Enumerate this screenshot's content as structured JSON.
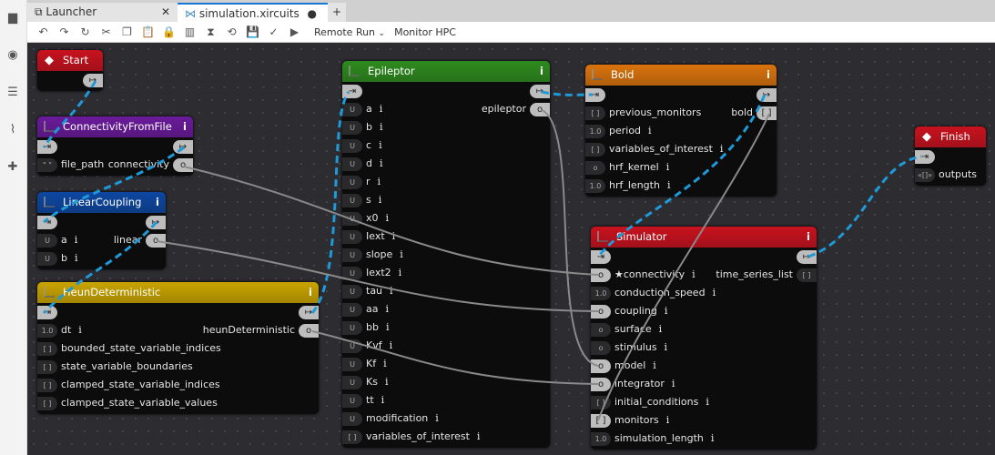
{
  "sidebar": {
    "icons": [
      "folder-icon",
      "running-icon",
      "list-icon",
      "xircuits-components-icon",
      "extension-icon"
    ]
  },
  "tabs": [
    {
      "label": "Launcher",
      "active": false
    },
    {
      "label": "simulation.xircuits",
      "active": true
    }
  ],
  "toolbar": {
    "icons": [
      "undo-icon",
      "redo-icon",
      "reload-icon",
      "cut-icon",
      "copy-icon",
      "paste-icon",
      "lock-icon",
      "compile-icon",
      "hourglass-icon",
      "debug-icon",
      "save-icon",
      "check-icon",
      "run-icon"
    ],
    "run_type": "Remote Run",
    "monitor": "Monitor HPC"
  },
  "colors": {
    "flow_link": "#1f9ad8",
    "data_link": "#8a8a8a"
  },
  "nodes": [
    {
      "id": "start",
      "title": "Start",
      "color": "#c8121e",
      "kind": "start",
      "rows": [
        {
          "out": {
            "badge": "⇥"
          }
        }
      ]
    },
    {
      "id": "cff",
      "title": "ConnectivityFromFile",
      "color": "#6a1b9a",
      "rows": [
        {
          "in": {
            "badge": "⇥"
          },
          "out": {
            "badge": "⇥"
          }
        },
        {
          "in": {
            "badge": "\" \"",
            "label": "file_path"
          },
          "out": {
            "badge": "o",
            "label": "connectivity",
            "light": true
          }
        }
      ]
    },
    {
      "id": "lc",
      "title": "LinearCoupling",
      "color": "#0d47a1",
      "rows": [
        {
          "in": {
            "badge": "⇥"
          },
          "out": {
            "badge": "⇥"
          }
        },
        {
          "in": {
            "badge": "U",
            "label": "a",
            "info": true
          },
          "out": {
            "badge": "o",
            "label": "linear",
            "light": true
          }
        },
        {
          "in": {
            "badge": "U",
            "label": "b",
            "info": true
          }
        }
      ]
    },
    {
      "id": "heun",
      "title": "HeunDeterministic",
      "color": "#c9a400",
      "rows": [
        {
          "in": {
            "badge": "⇥"
          },
          "out": {
            "badge": "⇥"
          }
        },
        {
          "in": {
            "badge": "1.0",
            "label": "dt",
            "info": true
          },
          "out": {
            "badge": "o",
            "label": "heunDeterministic",
            "light": true
          }
        },
        {
          "in": {
            "badge": "[ ]",
            "label": "bounded_state_variable_indices"
          }
        },
        {
          "in": {
            "badge": "[ ]",
            "label": "state_variable_boundaries"
          }
        },
        {
          "in": {
            "badge": "[ ]",
            "label": "clamped_state_variable_indices"
          }
        },
        {
          "in": {
            "badge": "[ ]",
            "label": "clamped_state_variable_values"
          }
        }
      ]
    },
    {
      "id": "epi",
      "title": "Epileptor",
      "color": "#2e8b1e",
      "rows": [
        {
          "in": {
            "badge": "⇥"
          },
          "out": {
            "badge": "⇥"
          }
        },
        {
          "in": {
            "badge": "U",
            "label": "a",
            "info": true
          },
          "out": {
            "badge": "o",
            "label": "epileptor",
            "light": true
          }
        },
        {
          "in": {
            "badge": "U",
            "label": "b",
            "info": true
          }
        },
        {
          "in": {
            "badge": "U",
            "label": "c",
            "info": true
          }
        },
        {
          "in": {
            "badge": "U",
            "label": "d",
            "info": true
          }
        },
        {
          "in": {
            "badge": "U",
            "label": "r",
            "info": true
          }
        },
        {
          "in": {
            "badge": "U",
            "label": "s",
            "info": true
          }
        },
        {
          "in": {
            "badge": "U",
            "label": "x0",
            "info": true
          }
        },
        {
          "in": {
            "badge": "U",
            "label": "Iext",
            "info": true
          }
        },
        {
          "in": {
            "badge": "U",
            "label": "slope",
            "info": true
          }
        },
        {
          "in": {
            "badge": "U",
            "label": "Iext2",
            "info": true
          }
        },
        {
          "in": {
            "badge": "U",
            "label": "tau",
            "info": true
          }
        },
        {
          "in": {
            "badge": "U",
            "label": "aa",
            "info": true
          }
        },
        {
          "in": {
            "badge": "U",
            "label": "bb",
            "info": true
          }
        },
        {
          "in": {
            "badge": "U",
            "label": "Kvf",
            "info": true
          }
        },
        {
          "in": {
            "badge": "U",
            "label": "Kf",
            "info": true
          }
        },
        {
          "in": {
            "badge": "U",
            "label": "Ks",
            "info": true
          }
        },
        {
          "in": {
            "badge": "U",
            "label": "tt",
            "info": true
          }
        },
        {
          "in": {
            "badge": "U",
            "label": "modification",
            "info": true
          }
        },
        {
          "in": {
            "badge": "[ ]",
            "label": "variables_of_interest",
            "info": true
          }
        }
      ]
    },
    {
      "id": "bold",
      "title": "Bold",
      "color": "#d9730d",
      "rows": [
        {
          "in": {
            "badge": "⇥"
          },
          "out": {
            "badge": "⇥"
          }
        },
        {
          "in": {
            "badge": "[ ]",
            "label": "previous_monitors"
          },
          "out": {
            "badge": "[ ]",
            "label": "bold",
            "light": true
          }
        },
        {
          "in": {
            "badge": "1.0",
            "label": "period",
            "info": true
          }
        },
        {
          "in": {
            "badge": "[ ]",
            "label": "variables_of_interest",
            "info": true
          }
        },
        {
          "in": {
            "badge": "o",
            "label": "hrf_kernel",
            "info": true
          }
        },
        {
          "in": {
            "badge": "1.0",
            "label": "hrf_length",
            "info": true
          }
        }
      ]
    },
    {
      "id": "sim",
      "title": "Simulator",
      "color": "#c8121e",
      "rows": [
        {
          "in": {
            "badge": "⇥"
          },
          "out": {
            "badge": "⇥"
          }
        },
        {
          "in": {
            "badge": "o",
            "label": "★connectivity",
            "info": true,
            "light": true
          },
          "out": {
            "badge": "[ ]",
            "label": "time_series_list"
          }
        },
        {
          "in": {
            "badge": "1.0",
            "label": "conduction_speed",
            "info": true
          }
        },
        {
          "in": {
            "badge": "o",
            "label": "coupling",
            "info": true,
            "light": true
          }
        },
        {
          "in": {
            "badge": "o",
            "label": "surface",
            "info": true
          }
        },
        {
          "in": {
            "badge": "o",
            "label": "stimulus",
            "info": true
          }
        },
        {
          "in": {
            "badge": "o",
            "label": "model",
            "info": true,
            "light": true
          }
        },
        {
          "in": {
            "badge": "o",
            "label": "integrator",
            "info": true,
            "light": true
          }
        },
        {
          "in": {
            "badge": "[ ]",
            "label": "initial_conditions",
            "info": true
          }
        },
        {
          "in": {
            "badge": "[ ]",
            "label": "monitors",
            "info": true,
            "light": true
          }
        },
        {
          "in": {
            "badge": "1.0",
            "label": "simulation_length",
            "info": true
          }
        }
      ]
    },
    {
      "id": "finish",
      "title": "Finish",
      "color": "#c8121e",
      "kind": "start",
      "rows": [
        {
          "in": {
            "badge": "⇥"
          }
        },
        {
          "in": {
            "badge": "«[]»",
            "label": "outputs"
          }
        }
      ]
    }
  ]
}
